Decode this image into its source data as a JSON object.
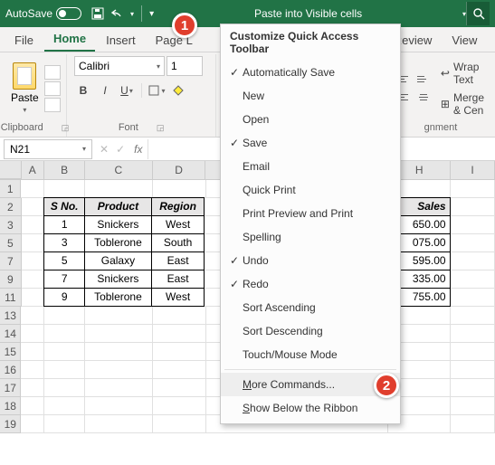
{
  "titlebar": {
    "autosave": "AutoSave",
    "title": "Paste into Visible cells"
  },
  "tabs": [
    "File",
    "Home",
    "Insert",
    "Page L",
    "",
    "",
    "",
    "Review",
    "View"
  ],
  "ribbon": {
    "paste_label": "Paste",
    "clipboard_label": "Clipboard",
    "font_name": "Calibri",
    "font_size": "1",
    "font_label": "Font",
    "alignment_label": "gnment",
    "wrap": "Wrap Text",
    "merge": "Merge & Cen"
  },
  "namebox": "N21",
  "columns": [
    "A",
    "B",
    "C",
    "D",
    "H",
    "I"
  ],
  "rows": [
    "1",
    "2",
    "3",
    "5",
    "7",
    "9",
    "11",
    "13",
    "14",
    "15",
    "16",
    "17",
    "18",
    "19"
  ],
  "table": {
    "headers": [
      "S No.",
      "Product",
      "Region",
      "Sales"
    ],
    "rows": [
      {
        "sno": "1",
        "product": "Snickers",
        "region": "West",
        "sales": "650.00"
      },
      {
        "sno": "3",
        "product": "Toblerone",
        "region": "South",
        "sales": "075.00"
      },
      {
        "sno": "5",
        "product": "Galaxy",
        "region": "East",
        "sales": "595.00"
      },
      {
        "sno": "7",
        "product": "Snickers",
        "region": "East",
        "sales": "335.00"
      },
      {
        "sno": "9",
        "product": "Toblerone",
        "region": "West",
        "sales": "755.00"
      }
    ]
  },
  "menu": {
    "title": "Customize Quick Access Toolbar",
    "items": [
      {
        "label": "Automatically Save",
        "checked": true
      },
      {
        "label": "New",
        "checked": false
      },
      {
        "label": "Open",
        "checked": false
      },
      {
        "label": "Save",
        "checked": true
      },
      {
        "label": "Email",
        "checked": false
      },
      {
        "label": "Quick Print",
        "checked": false
      },
      {
        "label": "Print Preview and Print",
        "checked": false
      },
      {
        "label": "Spelling",
        "checked": false
      },
      {
        "label": "Undo",
        "checked": true
      },
      {
        "label": "Redo",
        "checked": true
      },
      {
        "label": "Sort Ascending",
        "checked": false
      },
      {
        "label": "Sort Descending",
        "checked": false
      },
      {
        "label": "Touch/Mouse Mode",
        "checked": false
      }
    ],
    "more": "More Commands...",
    "below": "Show Below the Ribbon"
  },
  "badges": {
    "b1": "1",
    "b2": "2"
  }
}
